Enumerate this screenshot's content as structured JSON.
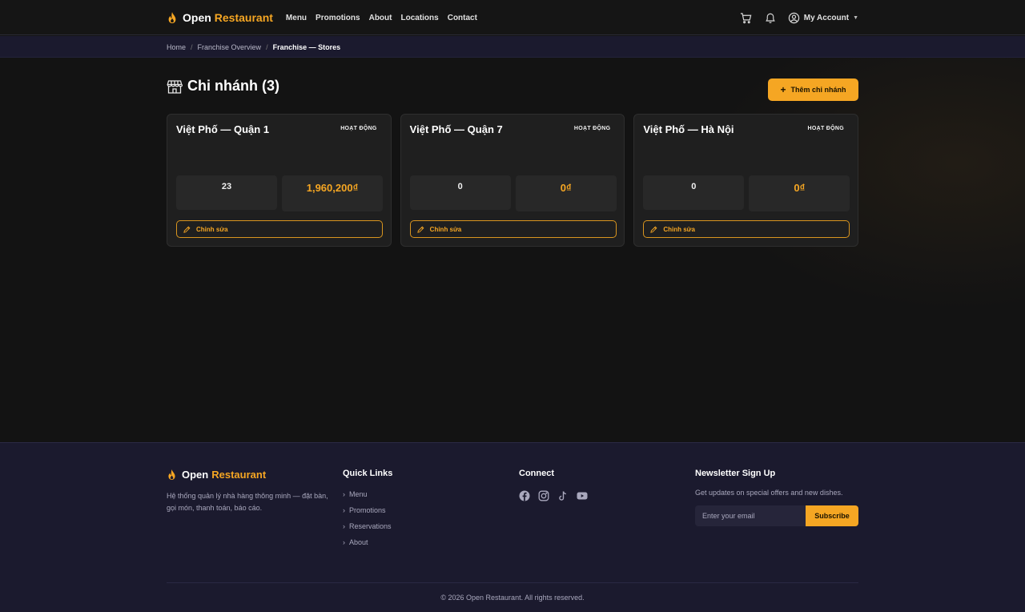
{
  "brand": {
    "name_part1": "Open",
    "name_part2": "Restaurant",
    "accent_color": "#f5a623"
  },
  "nav": {
    "items": [
      "Menu",
      "Promotions",
      "About",
      "Locations",
      "Contact"
    ],
    "cart_icon": "cart-icon",
    "bell_icon": "bell-icon",
    "account_label": "My Account"
  },
  "breadcrumb": {
    "items": [
      "Home",
      "Franchise Overview"
    ],
    "current": "Franchise — Stores"
  },
  "page": {
    "title": "Chi nhánh (3)",
    "add_button_label": "Thêm chi nhánh"
  },
  "stores": [
    {
      "name": "Việt Phố — Quận 1",
      "status": "HOẠT ĐỘNG",
      "orders": "23",
      "revenue": "1,960,200₫",
      "edit_label": "Chỉnh sửa"
    },
    {
      "name": "Việt Phố — Quận 7",
      "status": "HOẠT ĐỘNG",
      "orders": "0",
      "revenue": "0₫",
      "edit_label": "Chỉnh sửa"
    },
    {
      "name": "Việt Phố — Hà Nội",
      "status": "HOẠT ĐỘNG",
      "orders": "0",
      "revenue": "0₫",
      "edit_label": "Chỉnh sửa"
    }
  ],
  "footer": {
    "brand_part1": "Open",
    "brand_part2": "Restaurant",
    "description": "Hệ thống quản lý nhà hàng thông minh — đặt bàn, gọi món, thanh toán, báo cáo.",
    "quick_links_title": "Quick Links",
    "quick_links": [
      "Menu",
      "Promotions",
      "Reservations",
      "About"
    ],
    "connect_title": "Connect",
    "socials": [
      "facebook-icon",
      "instagram-icon",
      "tiktok-icon",
      "youtube-icon"
    ],
    "newsletter_title": "Newsletter Sign Up",
    "newsletter_text": "Get updates on special offers and new dishes.",
    "email_placeholder": "Enter your email",
    "subscribe_label": "Subscribe",
    "copyright": "© 2026 Open Restaurant. All rights reserved."
  }
}
